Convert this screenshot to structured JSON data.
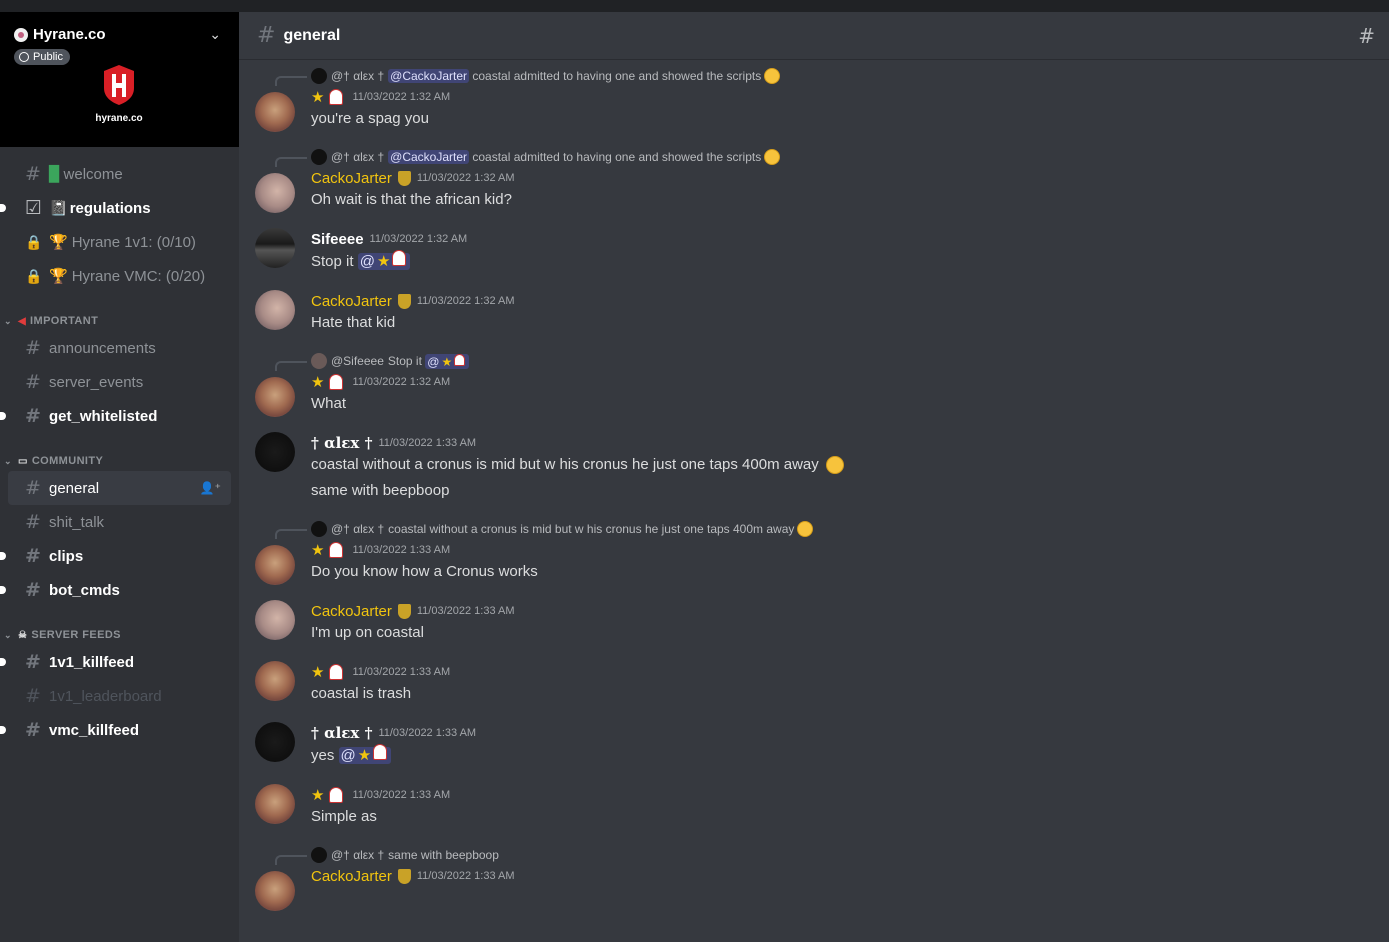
{
  "server": {
    "name": "Hyrane.co",
    "visibility": "Public",
    "logo_text": "hyrane.co"
  },
  "channels_top": [
    {
      "prefix": "",
      "label": "welcome",
      "emoji": "green-book"
    },
    {
      "prefix": "",
      "label": "regulations",
      "emoji": "notebook"
    },
    {
      "prefix": "",
      "label": "Hyrane 1v1: (0/10)",
      "emoji": "trophy"
    },
    {
      "prefix": "",
      "label": "Hyrane VMC: (0/20)",
      "emoji": "trophy"
    }
  ],
  "categories": {
    "important": {
      "label": "IMPORTANT",
      "channels": [
        "announcements",
        "server_events",
        "get_whitelisted"
      ]
    },
    "community": {
      "label": "COMMUNITY",
      "channels": [
        "general",
        "shit_talk",
        "clips",
        "bot_cmds"
      ]
    },
    "server_feeds": {
      "label": "SERVER FEEDS",
      "channels": [
        "1v1_killfeed",
        "1v1_leaderboard",
        "vmc_killfeed"
      ]
    }
  },
  "channel": {
    "name": "general"
  },
  "messages": [
    {
      "reply_user": "@† αlεx †",
      "reply_mention": "@CackoJarter",
      "reply_text": "coastal admitted to having one and showed the scripts",
      "ts": "11/03/2022 1:32 AM",
      "text": "you're a spag you"
    },
    {
      "reply_user": "@† αlεx †",
      "reply_mention": "@CackoJarter",
      "reply_text": "coastal admitted to having one and showed the scripts",
      "user": "CackoJarter",
      "ts": "11/03/2022 1:32 AM",
      "text": "Oh wait is that the african kid?"
    },
    {
      "user": "Sifeeee",
      "ts": "11/03/2022 1:32 AM",
      "text": "Stop it",
      "mention": "@"
    },
    {
      "user": "CackoJarter",
      "ts": "11/03/2022 1:32 AM",
      "text": "Hate that kid"
    },
    {
      "reply_user": "@Sifeeee",
      "reply_text": "Stop it",
      "reply_mention": "@",
      "ts": "11/03/2022 1:32 AM",
      "text": "What"
    },
    {
      "user": "† αlεx †",
      "ts": "11/03/2022 1:33 AM",
      "text": "coastal without a cronus is mid but w his cronus he just one taps 400m away",
      "text2": "same with beepboop"
    },
    {
      "reply_user": "@† αlεx †",
      "reply_text": "coastal without a cronus is mid but w his cronus he just one taps 400m away",
      "ts": "11/03/2022 1:33 AM",
      "text": "Do you know how a Cronus works"
    },
    {
      "user": "CackoJarter",
      "ts": "11/03/2022 1:33 AM",
      "text": "I'm up on coastal"
    },
    {
      "ts": "11/03/2022 1:33 AM",
      "text": "coastal is trash"
    },
    {
      "user": "† αlεx †",
      "ts": "11/03/2022 1:33 AM",
      "text": "yes",
      "mention": "@"
    },
    {
      "ts": "11/03/2022 1:33 AM",
      "text": "Simple as"
    },
    {
      "reply_user": "@† αlεx †",
      "reply_text": "same with beepboop",
      "user": "CackoJarter",
      "ts": "11/03/2022 1:33 AM"
    }
  ]
}
